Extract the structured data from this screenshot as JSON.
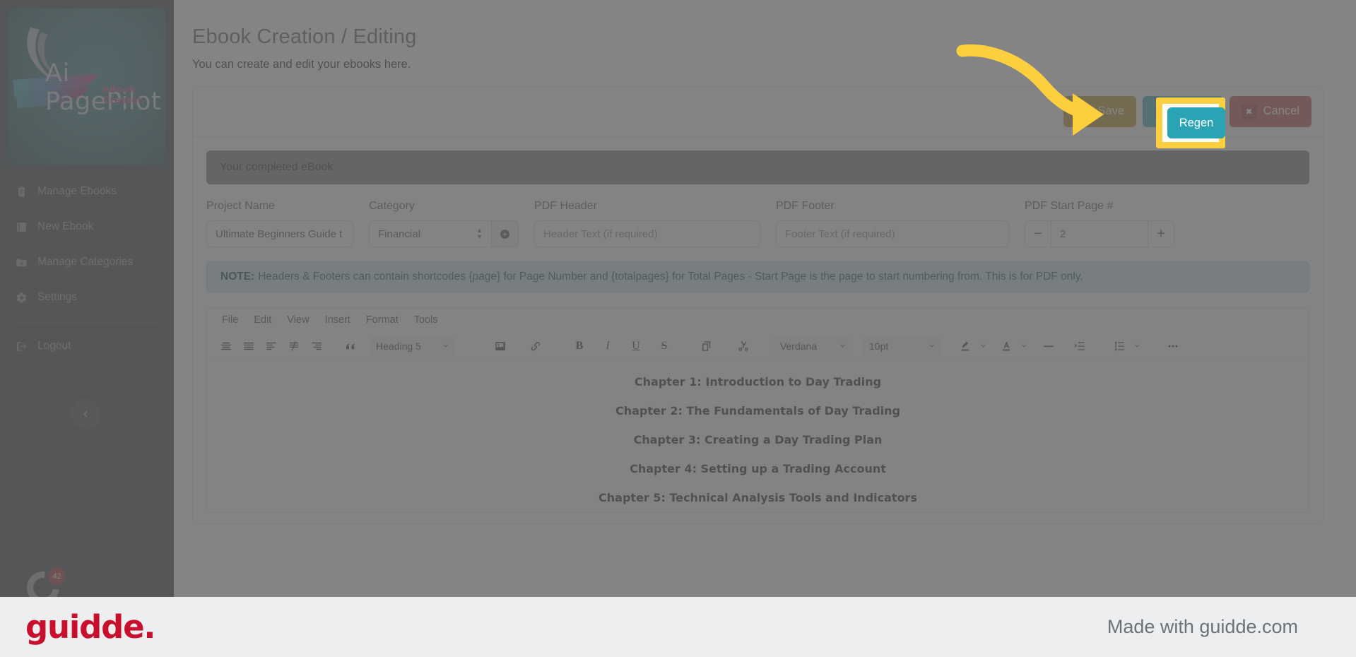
{
  "sidebar": {
    "logo": {
      "name": "Ai PagePilot",
      "tagline": "eBook Creator."
    },
    "items": [
      {
        "label": "Manage Ebooks",
        "icon": "clipboard-icon"
      },
      {
        "label": "New Ebook",
        "icon": "book-icon"
      },
      {
        "label": "Manage Categories",
        "icon": "folder-plus-icon"
      },
      {
        "label": "Settings",
        "icon": "gear-icon"
      },
      {
        "label": "Logout",
        "icon": "logout-icon"
      }
    ],
    "collapse_icon": "chevron-left-icon",
    "notification_count": "42"
  },
  "header": {
    "title": "Ebook Creation / Editing",
    "subtitle": "You can create and edit your ebooks here."
  },
  "actions": {
    "save_label": "Save",
    "save_icon": "save-icon",
    "regen_label": "Regen",
    "regen_icon": "refresh-icon",
    "cancel_label": "Cancel",
    "cancel_icon": "close-icon",
    "save_color": "#b08a0b",
    "regen_color": "#2aa3b5",
    "cancel_color": "#b33b2e"
  },
  "status_banner": {
    "text": "Your completed eBook"
  },
  "form": {
    "project_name": {
      "label": "Project Name",
      "value": "Ultimate Beginners Guide t"
    },
    "category": {
      "label": "Category",
      "value": "Financial",
      "add_icon": "plus-circle-icon"
    },
    "pdf_header": {
      "label": "PDF Header",
      "placeholder": "Header Text (if required)",
      "value": ""
    },
    "pdf_footer": {
      "label": "PDF Footer",
      "placeholder": "Footer Text (if required)",
      "value": ""
    },
    "pdf_start_page": {
      "label": "PDF Start Page #",
      "value": "2",
      "decrement": "−",
      "increment": "+"
    }
  },
  "note": {
    "prefix": "NOTE:",
    "text": "Headers & Footers can contain shortcodes {page} for Page Number and {totalpages} for Total Pages - Start Page is the page to start numbering from. This is for PDF only."
  },
  "editor": {
    "menus": [
      "File",
      "Edit",
      "View",
      "Insert",
      "Format",
      "Tools"
    ],
    "format_select": "Heading 5",
    "font_select": "Verdana",
    "size_select": "10pt",
    "tools_row1": [
      "align-justify-center-icon",
      "align-justify-icon",
      "align-left-icon",
      "align-none-icon",
      "align-right-icon"
    ],
    "tools_row2": [
      "blockquote-icon",
      "image-icon",
      "link-icon",
      "bold-icon",
      "italic-icon",
      "underline-icon",
      "strikethrough-icon",
      "copy-icon",
      "cut-icon",
      "text-highlight-icon",
      "text-color-icon",
      "horizontal-rule-icon",
      "indent-icon",
      "line-height-icon",
      "more-options-icon"
    ],
    "content": [
      "Chapter 1: Introduction to Day Trading",
      "Chapter 2: The Fundamentals of Day Trading",
      "Chapter 3: Creating a Day Trading Plan",
      "Chapter 4: Setting up a Trading Account",
      "Chapter 5: Technical Analysis Tools and Indicators"
    ]
  },
  "highlight": {
    "target_label": "Regen",
    "frame_color": "#FCCF3E",
    "arrow_color": "#FCCF3E"
  },
  "footer": {
    "brand": "guidde.",
    "made_with": "Made with guidde.com",
    "brand_color": "#c8102e"
  }
}
